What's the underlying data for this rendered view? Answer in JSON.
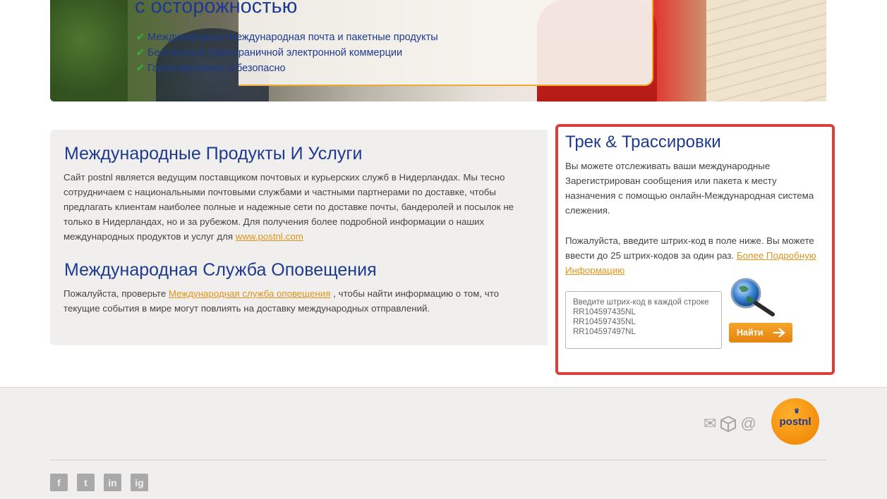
{
  "hero": {
    "title": "с осторожностью",
    "bullets": [
      "Международная Международная почта и пакетные продукты",
      "Безопасный трансграничной электронной коммерции",
      "Гарантированно и безопасно"
    ]
  },
  "products": {
    "title": "Международные Продукты И Услуги",
    "text": "Сайт postnl является ведущим поставщиком почтовых и курьерских служб в Нидерландах. Мы тесно сотрудничаем с национальными почтовыми службами и частными партнерами по доставке, чтобы предлагать клиентам наиболее полные и надежные сети по доставке почты, бандеролей и посылок не только в Нидерландах, но и за рубежом. Для получения более подробной информации о наших международных продуктов и услуг для ",
    "link": "www.postnl.com"
  },
  "alert": {
    "title": "Международная Служба Оповещения",
    "text_before": "Пожалуйста, проверьте ",
    "link": "Международная служба оповещения",
    "text_after": " , чтобы найти информацию о том, что текущие события в мире могут повлиять на доставку международных отправлений."
  },
  "tracking": {
    "title": "Трек & Трассировки",
    "desc": "Вы можете отслеживать ваши международные Зарегистрирован сообщения или пакета к месту назначения с помощью онлайн-Международная система слежения.",
    "instruction": "Пожалуйста, введите штрих-код в поле ниже. Вы можете ввести до 25 штрих-кодов за один раз. ",
    "more_link": "Более Подробную Информацию",
    "input_value": "Введите штрих-код в каждой строке\nRR104597435NL\nRR104597435NL\nRR104597497NL",
    "button": "Найти"
  },
  "footer": {
    "logo": "postnl",
    "social": [
      "f",
      "t",
      "in",
      "ig"
    ]
  },
  "colors": {
    "brand_blue": "#1d3a8f",
    "accent_orange": "#f38c0b",
    "highlight_red": "#d9403a"
  }
}
